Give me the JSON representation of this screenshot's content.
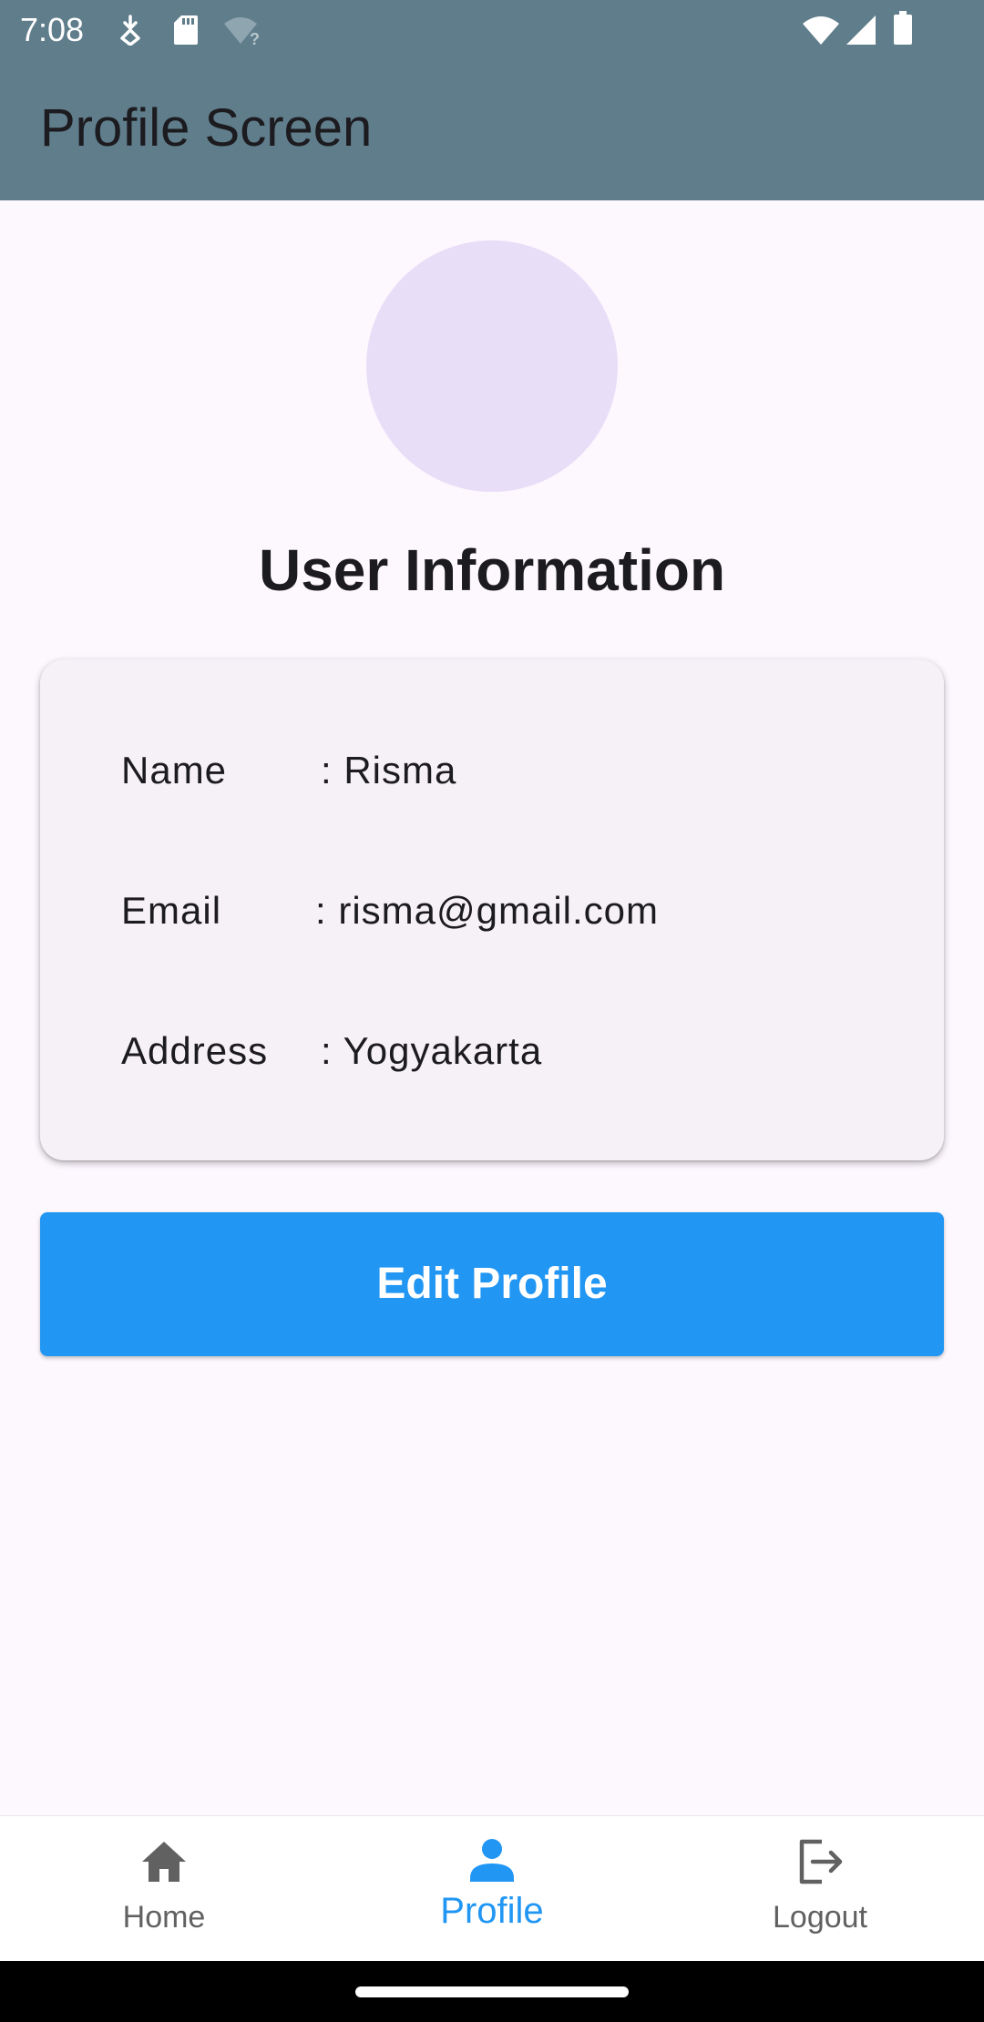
{
  "status_bar": {
    "time": "7:08",
    "icons": [
      "download-badge-icon",
      "sd-card-icon",
      "wifi-question-icon",
      "wifi-icon",
      "signal-icon",
      "battery-icon"
    ]
  },
  "app_bar": {
    "title": "Profile Screen",
    "background_color": "#607D8B"
  },
  "profile": {
    "avatar_color": "#E8DEF8",
    "section_title": "User Information",
    "fields": [
      {
        "label": "Name",
        "value": ": Risma"
      },
      {
        "label": "Email",
        "value": ": risma@gmail.com"
      },
      {
        "label": "Address",
        "value": ": Yogyakarta"
      }
    ],
    "edit_button_label": "Edit Profile",
    "edit_button_color": "#2196F3"
  },
  "bottom_nav": {
    "items": [
      {
        "label": "Home",
        "icon": "home-icon",
        "active": false
      },
      {
        "label": "Profile",
        "icon": "person-icon",
        "active": true
      },
      {
        "label": "Logout",
        "icon": "logout-icon",
        "active": false
      }
    ],
    "active_color": "#2196F3",
    "inactive_color": "#616161"
  }
}
